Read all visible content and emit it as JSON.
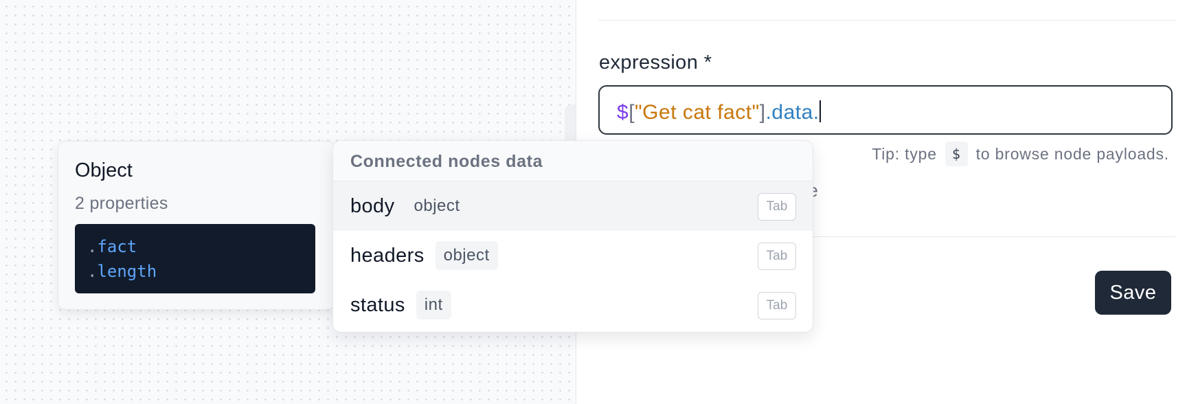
{
  "object_card": {
    "title": "Object",
    "subtitle": "2 properties",
    "properties": [
      ".fact",
      ".length"
    ]
  },
  "form": {
    "field_label": "expression *",
    "expression": {
      "dollar": "$",
      "open_bracket": "[",
      "string": "\"Get cat fact\"",
      "close_bracket": "]",
      "property": ".data."
    },
    "tip_prefix": "Tip: type",
    "tip_key": "$",
    "tip_suffix": "to browse node payloads.",
    "partially_hidden_text": "uate",
    "save_label": "Save"
  },
  "dropdown": {
    "header": "Connected nodes data",
    "items": [
      {
        "name": "body",
        "type": "object",
        "hint": "Tab",
        "active": true
      },
      {
        "name": "headers",
        "type": "object",
        "hint": "Tab",
        "active": false
      },
      {
        "name": "status",
        "type": "int",
        "hint": "Tab",
        "active": false
      }
    ]
  },
  "colors": {
    "save_button": "#1f2937",
    "code_block": "#111b2b",
    "expr_dollar": "#7c3aed",
    "expr_string": "#c77609",
    "expr_property": "#2f7fc0"
  }
}
